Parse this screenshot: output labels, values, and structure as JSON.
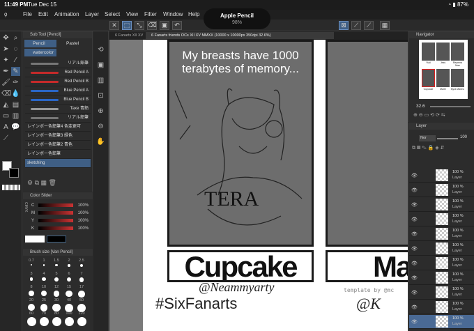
{
  "status": {
    "time": "11:49 PM",
    "date": "Tue Dec 15",
    "battery": "87%"
  },
  "menu": {
    "items": [
      "File",
      "Edit",
      "Animation",
      "Layer",
      "Select",
      "View",
      "Filter",
      "Window",
      "Help"
    ]
  },
  "pencil": {
    "title": "Apple Pencil",
    "battery": "98%"
  },
  "subtool": {
    "title": "Sub Tool [Pencil]",
    "tabs": [
      "Pencil",
      "Pastel"
    ],
    "category": "watercolor",
    "brushes": [
      "リアル鉛筆",
      "Red Pencil A",
      "Red Pencil B",
      "Blue Pencil A",
      "Blue Pencil B",
      "Taxe 青鉛",
      "リアル鉛筆",
      "レインボー色鉛筆4 色変更可",
      "レインボー色鉛筆3 緑色",
      "レインボー色鉛筆2 青色",
      "レインボー色鉛筆",
      "sketching"
    ]
  },
  "color_slider": {
    "title": "Color Slider",
    "mode": "CMYK",
    "channels": [
      {
        "name": "C",
        "value": "100%"
      },
      {
        "name": "M",
        "value": "100%"
      },
      {
        "name": "Y",
        "value": "100%"
      },
      {
        "name": "K",
        "value": "100%"
      }
    ]
  },
  "brush_size": {
    "title": "Brush size [Van Pencil]",
    "sizes": [
      "0.7",
      "1",
      "1.5",
      "2",
      "2.5",
      "3",
      "4",
      "5",
      "6",
      "7",
      "8",
      "10",
      "12",
      "15",
      "17",
      "20",
      "25",
      "30",
      "40",
      "50",
      "60",
      "70",
      "80",
      "100",
      "120"
    ]
  },
  "doc_tabs": [
    "6 Fanarts XII XV",
    "6 Fanarts friends OCs XII XV MMXX (10000 x 10000px 350dpi 32.6%)"
  ],
  "canvas": {
    "caption": "My breasts have 1000 terabytes of memory...",
    "shirt_text": "TERA",
    "name1": "Cupcake",
    "name2": "Mar",
    "handle": "@Neammyarty",
    "hashtag": "#SixFanarts",
    "template_note": "template by @mc",
    "handle2": "@K"
  },
  "navigator": {
    "title": "Navigator",
    "zoom": "32.6",
    "labels": [
      "Yuki",
      "Jess",
      "Reyrena Mae",
      "Cupcake",
      "Marle",
      "Byra Marieu"
    ]
  },
  "layers": {
    "title": "Layer",
    "blend": "Nor",
    "opacity": "100",
    "items": [
      {
        "pct": "100 %",
        "name": "Layer"
      },
      {
        "pct": "100 %",
        "name": "Layer"
      },
      {
        "pct": "100 %",
        "name": "Layer"
      },
      {
        "pct": "100 %",
        "name": "Layer"
      },
      {
        "pct": "100 %",
        "name": "Layer"
      },
      {
        "pct": "100 %",
        "name": "Layer"
      },
      {
        "pct": "100 %",
        "name": "Layer"
      },
      {
        "pct": "100 %",
        "name": "Layer"
      },
      {
        "pct": "100 %",
        "name": "Layer"
      },
      {
        "pct": "100 %",
        "name": "Layer"
      },
      {
        "pct": "100 %",
        "name": "Layer"
      }
    ]
  }
}
